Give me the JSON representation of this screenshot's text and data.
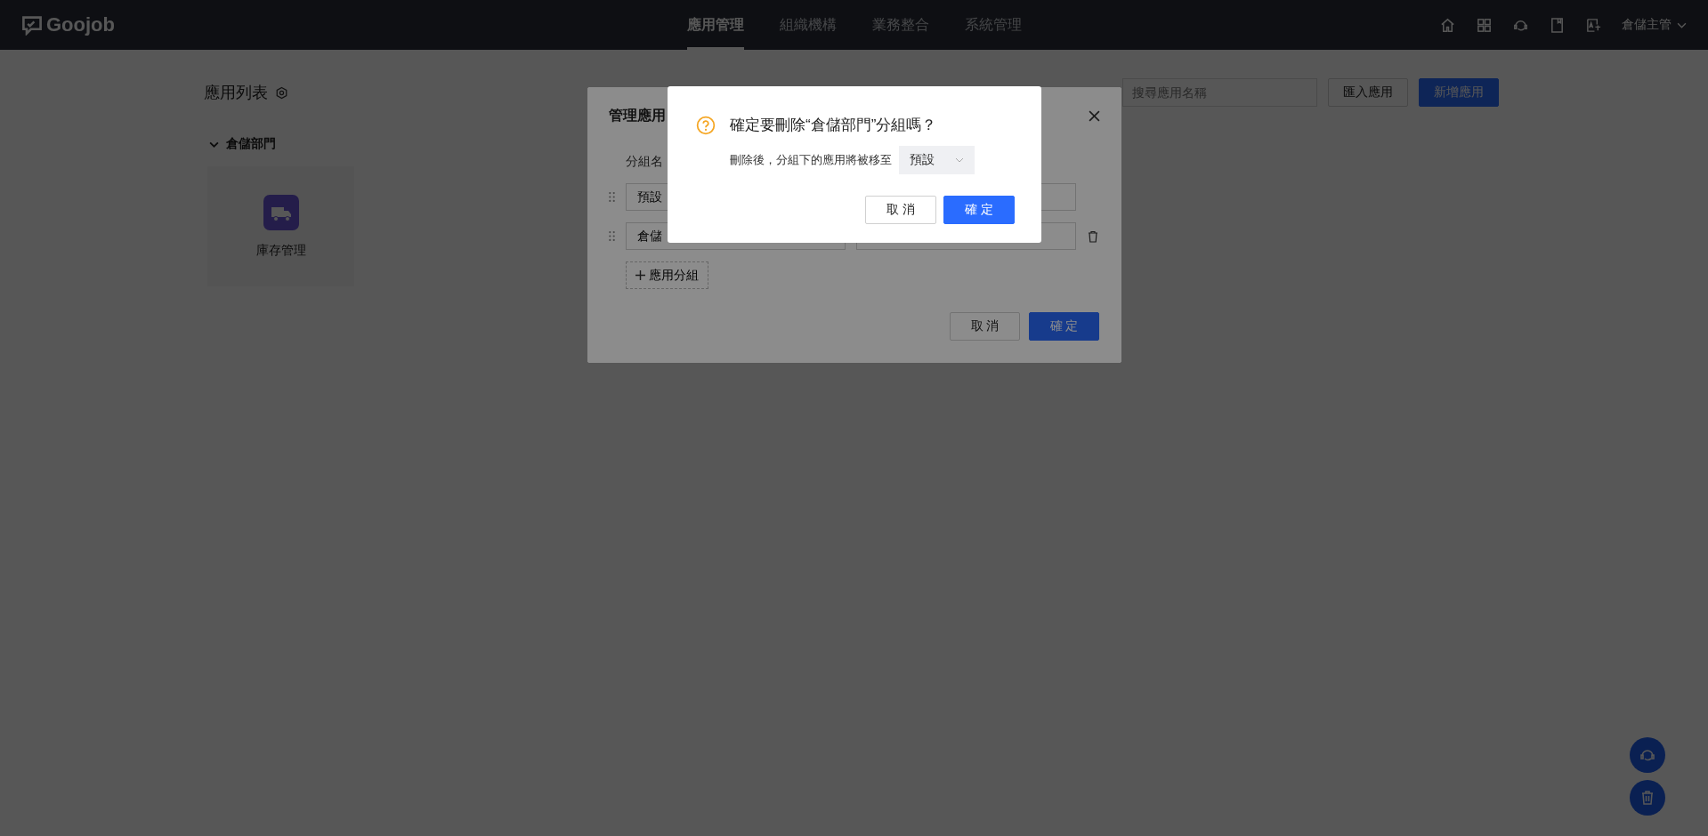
{
  "header": {
    "logo": "Goojob",
    "nav": [
      {
        "label": "應用管理",
        "selected": true
      },
      {
        "label": "組織機構",
        "selected": false
      },
      {
        "label": "業務整合",
        "selected": false
      },
      {
        "label": "系統管理",
        "selected": false
      }
    ],
    "user": "倉儲主管"
  },
  "page": {
    "title": "應用列表",
    "search": {
      "placeholder": "搜尋應用名稱"
    },
    "buttons": [
      {
        "label": "匯入應用",
        "kind": "default"
      },
      {
        "label": "新增應用",
        "kind": "primary"
      }
    ],
    "groups": [
      {
        "name": "倉儲部門",
        "expanded": true,
        "apps": [
          {
            "name": "庫存管理"
          }
        ]
      }
    ]
  },
  "manage_dialog": {
    "title": "管理應用",
    "column_1": "分組名",
    "rows": [
      {
        "name": "預設",
        "deletable": false
      },
      {
        "name": "倉儲",
        "deletable": true
      }
    ],
    "add_button": "應用分組",
    "cancel": "取 消",
    "ok": "確 定"
  },
  "confirm_dialog": {
    "title": "確定要刪除“倉儲部門”分組嗎？",
    "message": "刪除後，分組下的應用將被移至",
    "select": {
      "value": "預設"
    },
    "cancel": "取 消",
    "ok": "確 定"
  }
}
